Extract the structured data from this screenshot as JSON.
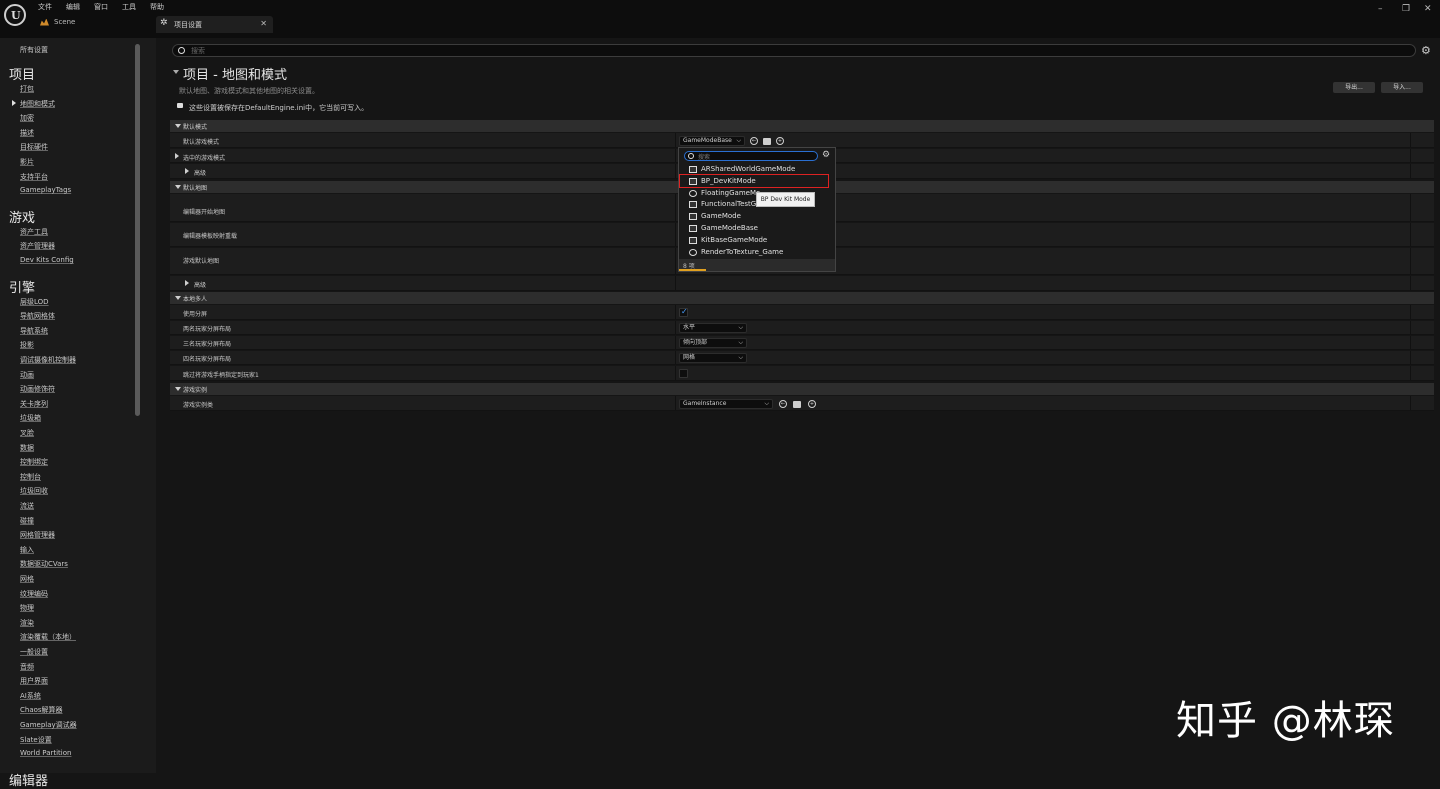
{
  "menubar": {
    "items": [
      "文件",
      "编辑",
      "窗口",
      "工具",
      "帮助"
    ]
  },
  "tabs": {
    "scene_label": "Scene",
    "project_settings_label": "项目设置"
  },
  "window_controls": {
    "minimize": "–",
    "maximize": "❐",
    "close": "✕"
  },
  "sidebar": {
    "all_settings": "所有设置",
    "sections": [
      {
        "title": "项目",
        "items": [
          "打包",
          "地图和模式",
          "加密",
          "描述",
          "目标硬件",
          "影片",
          "支持平台",
          "GameplayTags"
        ]
      },
      {
        "title": "游戏",
        "items": [
          "资产工具",
          "资产管理器",
          "Dev Kits Config"
        ]
      },
      {
        "title": "引擎",
        "items": [
          "层级LOD",
          "导航网格体",
          "导航系统",
          "投影",
          "调试摄像机控制器",
          "动画",
          "动画修饰符",
          "关卡序列",
          "垃圾箱",
          "叉脸",
          "数据",
          "控制绑定",
          "控制台",
          "垃圾回收",
          "流送",
          "碰撞",
          "网格管理器",
          "输入",
          "数据驱动CVars",
          "网格",
          "纹理编码",
          "物理",
          "渲染",
          "渲染覆载（本地）",
          "一般设置",
          "音频",
          "用户界面",
          "AI系统",
          "Chaos解算器",
          "Gameplay调试器",
          "Slate设置",
          "World Partition"
        ]
      },
      {
        "title": "编辑器",
        "items": []
      }
    ]
  },
  "search": {
    "placeholder": "搜索"
  },
  "page": {
    "title": "项目 - 地图和模式",
    "subtitle": "默认地图、游戏模式和其他地图的相关设置。",
    "note": "这些设置被保存在DefaultEngine.ini中，它当前可写入。",
    "export_label": "导出...",
    "import_label": "导入..."
  },
  "sections": {
    "default_modes": "默认模式",
    "default_game_mode": "默认游戏模式",
    "selected_game_mode": "选中的游戏模式",
    "advanced1": "高级",
    "default_maps": "默认地图",
    "editor_startup_map": "编辑器开始地图",
    "editor_template_map": "编辑器模板映射重载",
    "game_default_map": "游戏默认地图",
    "advanced2": "高级",
    "local_multiplayer": "本地多人",
    "use_splitscreen": "使用分屏",
    "two_player_layout": "两名玩家分屏布局",
    "three_player_layout": "三名玩家分屏布局",
    "four_player_layout": "四名玩家分屏布局",
    "skip_assigning_gamepad": "跳过将游戏手柄指定到玩家1",
    "game_instance": "游戏实例",
    "game_instance_class": "游戏实例类"
  },
  "values": {
    "game_mode_dropdown": "GameModeBase",
    "two_player_layout": "水平",
    "three_player_layout": "倾向顶部",
    "four_player_layout": "网格",
    "game_instance_dropdown": "GameInstance"
  },
  "popup": {
    "search_placeholder": "搜索",
    "items": [
      "ARSharedWorldGameMode",
      "BP_DevKitMode",
      "FloatingGameMo",
      "FunctionalTestG",
      "GameMode",
      "GameModeBase",
      "KitBaseGameMode",
      "RenderToTexture_Game"
    ],
    "item_icons": [
      "box",
      "box",
      "round",
      "box",
      "box",
      "box",
      "box",
      "round"
    ],
    "selected_index": 1,
    "footer": "8 项",
    "tooltip": "BP Dev Kit Mode"
  },
  "watermark": "知乎 @林琛",
  "colors": {
    "accent_blue": "#2a6fd1",
    "highlight_red": "#dd2222",
    "footer_bar": "#e0a020"
  }
}
